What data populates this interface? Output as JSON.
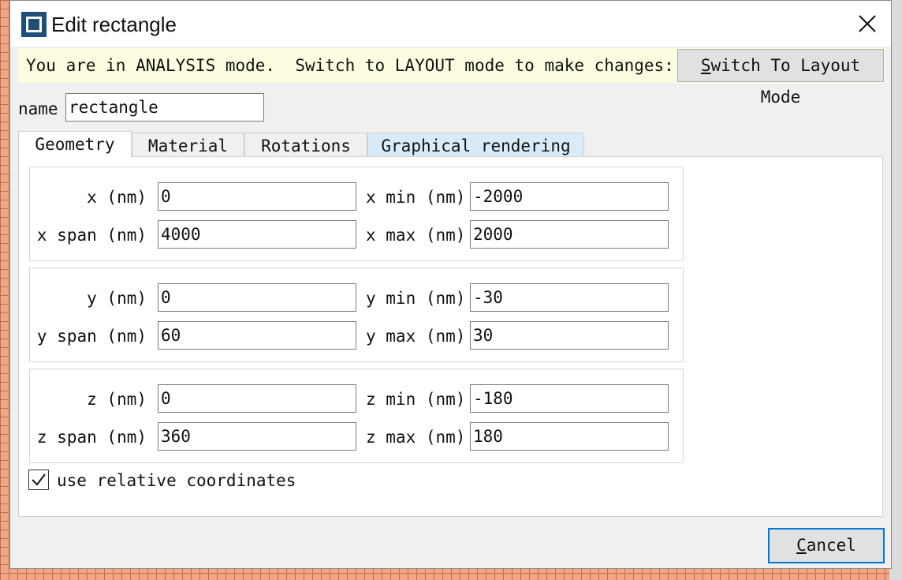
{
  "window": {
    "title": "Edit rectangle",
    "close_icon": "close-icon",
    "app_icon": "app-icon"
  },
  "banner": {
    "text": "You are in ANALYSIS mode.  Switch to LAYOUT mode to make changes:",
    "switch_button_label": "Switch To Layout Mode",
    "background": "#fcfce0"
  },
  "name": {
    "label": "name",
    "value": "rectangle"
  },
  "tabs": [
    {
      "label": "Geometry",
      "active": true
    },
    {
      "label": "Material",
      "active": false
    },
    {
      "label": "Rotations",
      "active": false
    },
    {
      "label": "Graphical rendering",
      "active": false
    }
  ],
  "geometry": {
    "groups": [
      {
        "center_label": "x (nm)",
        "center_value": "0",
        "span_label": "x span (nm)",
        "span_value": "4000",
        "min_label": "x min (nm)",
        "min_value": "-2000",
        "max_label": "x max (nm)",
        "max_value": "2000"
      },
      {
        "center_label": "y (nm)",
        "center_value": "0",
        "span_label": "y span (nm)",
        "span_value": "60",
        "min_label": "y min (nm)",
        "min_value": "-30",
        "max_label": "y max (nm)",
        "max_value": "30"
      },
      {
        "center_label": "z (nm)",
        "center_value": "0",
        "span_label": "z span (nm)",
        "span_value": "360",
        "min_label": "z min (nm)",
        "min_value": "-180",
        "max_label": "z max (nm)",
        "max_value": "180"
      }
    ],
    "relative_coords": {
      "label": "use relative coordinates",
      "checked": true
    }
  },
  "footer": {
    "cancel_label": "Cancel"
  },
  "colors": {
    "accent": "#0078d7",
    "app_icon": "#1f4e79",
    "tab_highlight": "#d9ebf9"
  }
}
